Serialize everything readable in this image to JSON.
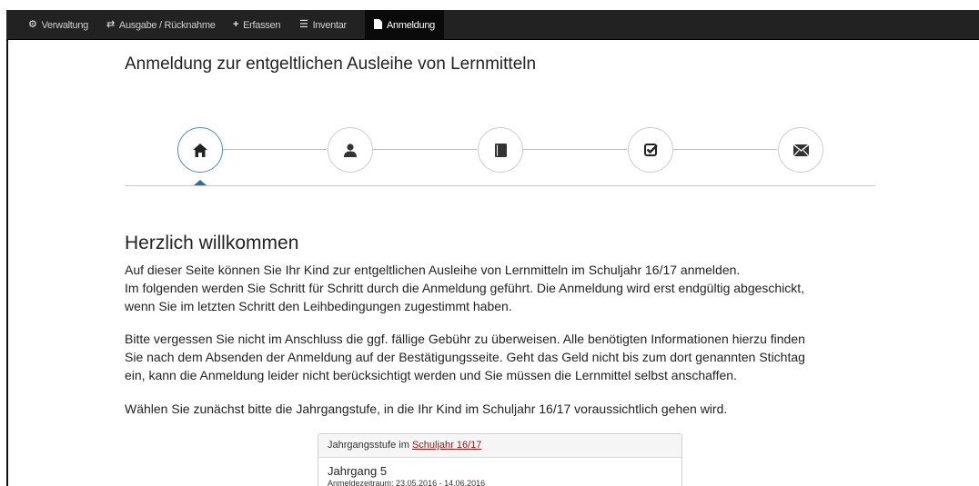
{
  "navbar": {
    "items": [
      {
        "label": "Verwaltung",
        "icon": "gear-icon"
      },
      {
        "label": "Ausgabe / Rücknahme",
        "icon": "retweet-icon"
      },
      {
        "label": "Erfassen",
        "icon": "plus-icon"
      },
      {
        "label": "Inventar",
        "icon": "list-icon"
      },
      {
        "label": "Anmeldung",
        "icon": "file-icon"
      }
    ],
    "active": "Anmeldung"
  },
  "page": {
    "title": "Anmeldung zur entgeltlichen Ausleihe von Lernmitteln"
  },
  "wizard": {
    "steps": [
      {
        "icon": "home-icon"
      },
      {
        "icon": "user-icon"
      },
      {
        "icon": "book-icon"
      },
      {
        "icon": "check-square-icon"
      },
      {
        "icon": "envelope-icon"
      }
    ],
    "active_step": 1
  },
  "welcome": {
    "heading": "Herzlich willkommen",
    "p1_line1": "Auf dieser Seite können Sie Ihr Kind zur entgeltlichen Ausleihe von Lernmitteln im Schuljahr 16/17 anmelden.",
    "p1_line2": "Im folgenden werden Sie Schritt für Schritt durch die Anmeldung geführt. Die Anmeldung wird erst endgültig abgeschickt,",
    "p1_line3": "wenn Sie im letzten Schritt den Leihbedingungen zugestimmt haben.",
    "p2_line1": "Bitte vergessen Sie nicht im Anschluss die ggf. fällige Gebühr zu überweisen. Alle benötigten Informationen hierzu finden",
    "p2_line2": "Sie nach dem Absenden der Anmeldung auf der Bestätigungsseite. Geht das Geld nicht bis zum dort genannten Stichtag",
    "p2_line3": "ein, kann die Anmeldung leider nicht berücksichtigt werden und Sie müssen die Lernmittel selbst anschaffen.",
    "p3": "Wählen Sie zunächst bitte die Jahrgangstufe, in die Ihr Kind im Schuljahr 16/17 voraussichtlich gehen wird."
  },
  "panel": {
    "heading_prefix": "Jahrgangsstufe im ",
    "heading_link": "Schuljahr 16/17",
    "grade": "Jahrgang 5",
    "period": "Anmeldezeitraum: 23.05.2016 - 14.06.2016"
  },
  "colors": {
    "navbar_bg": "#222222",
    "active_step_border": "#4a8fb8",
    "link": "#8b1a1a"
  }
}
